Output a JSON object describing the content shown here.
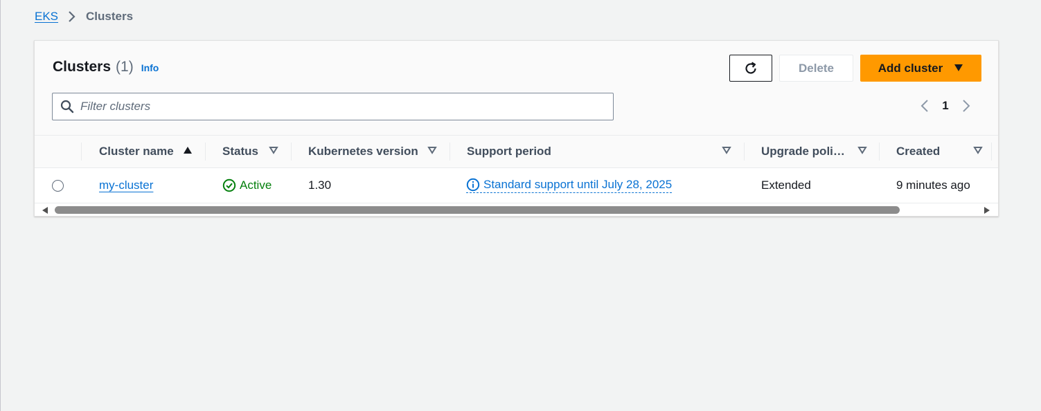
{
  "breadcrumb": {
    "root": "EKS",
    "current": "Clusters"
  },
  "header": {
    "title": "Clusters",
    "count": "(1)",
    "info": "Info"
  },
  "actions": {
    "refresh_icon": "refresh-icon",
    "delete_label": "Delete",
    "add_label": "Add cluster"
  },
  "filter": {
    "placeholder": "Filter clusters",
    "value": ""
  },
  "pagination": {
    "current_page": "1"
  },
  "table": {
    "columns": [
      "Cluster name",
      "Status",
      "Kubernetes version",
      "Support period",
      "Upgrade poli…",
      "Created"
    ],
    "sorted_column": "Cluster name",
    "sort_direction": "ascending",
    "rows": [
      {
        "selected": false,
        "name": "my-cluster",
        "status": "Active",
        "kubernetes_version": "1.30",
        "support_period": "Standard support until July 28, 2025",
        "upgrade_policy": "Extended",
        "created": "9 minutes ago"
      }
    ]
  },
  "colors": {
    "link": "#0972d3",
    "primary_button": "#ff9900",
    "status_success": "#037f0c",
    "background": "#f2f3f3"
  }
}
